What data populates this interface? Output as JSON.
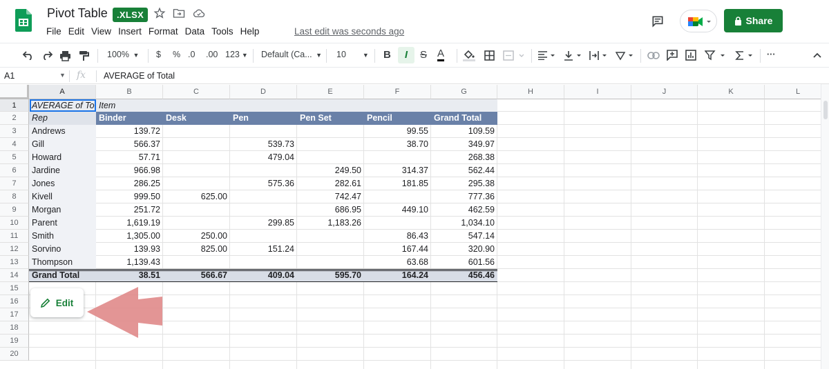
{
  "app": {
    "doc_title": "Pivot Table",
    "file_badge": ".XLSX",
    "menu": [
      "File",
      "Edit",
      "View",
      "Insert",
      "Format",
      "Data",
      "Tools",
      "Help"
    ],
    "last_edit": "Last edit was seconds ago",
    "share_label": "Share"
  },
  "toolbar": {
    "zoom": "100%",
    "currency": "$",
    "percent": "%",
    "dec_decrease": ".0",
    "dec_increase": ".00",
    "more_formats": "123",
    "font": "Default (Ca...",
    "font_size": "10",
    "bold": "B",
    "italic": "I",
    "strike": "S",
    "text_color": "A",
    "more": "···"
  },
  "formula_bar": {
    "cell_ref": "A1",
    "fx": "fx",
    "value": "AVERAGE of Total"
  },
  "columns": [
    "A",
    "B",
    "C",
    "D",
    "E",
    "F",
    "G",
    "H",
    "I",
    "J",
    "K",
    "L"
  ],
  "rows": [
    "1",
    "2",
    "3",
    "4",
    "5",
    "6",
    "7",
    "8",
    "9",
    "10",
    "11",
    "12",
    "13",
    "14",
    "15",
    "16",
    "17",
    "18",
    "19",
    "20"
  ],
  "pivot": {
    "corner_label": "AVERAGE of Tota",
    "col_field": "Item",
    "row_field": "Rep",
    "headers": [
      "Binder",
      "Desk",
      "Pen",
      "Pen Set",
      "Pencil",
      "Grand Total"
    ],
    "data": [
      {
        "rep": "Andrews",
        "vals": [
          "139.72",
          "",
          "",
          "",
          "99.55",
          "109.59"
        ]
      },
      {
        "rep": "Gill",
        "vals": [
          "566.37",
          "",
          "539.73",
          "",
          "38.70",
          "349.97"
        ]
      },
      {
        "rep": "Howard",
        "vals": [
          "57.71",
          "",
          "479.04",
          "",
          "",
          "268.38"
        ]
      },
      {
        "rep": "Jardine",
        "vals": [
          "966.98",
          "",
          "",
          "249.50",
          "314.37",
          "562.44"
        ]
      },
      {
        "rep": "Jones",
        "vals": [
          "286.25",
          "",
          "575.36",
          "282.61",
          "181.85",
          "295.38"
        ]
      },
      {
        "rep": "Kivell",
        "vals": [
          "999.50",
          "625.00",
          "",
          "742.47",
          "",
          "777.36"
        ]
      },
      {
        "rep": "Morgan",
        "vals": [
          "251.72",
          "",
          "",
          "686.95",
          "449.10",
          "462.59"
        ]
      },
      {
        "rep": "Parent",
        "vals": [
          "1,619.19",
          "",
          "299.85",
          "1,183.26",
          "",
          "1,034.10"
        ]
      },
      {
        "rep": "Smith",
        "vals": [
          "1,305.00",
          "250.00",
          "",
          "",
          "86.43",
          "547.14"
        ]
      },
      {
        "rep": "Sorvino",
        "vals": [
          "139.93",
          "825.00",
          "151.24",
          "",
          "167.44",
          "320.90"
        ]
      },
      {
        "rep": "Thompson",
        "vals": [
          "1,139.43",
          "",
          "",
          "",
          "63.68",
          "601.56"
        ]
      }
    ],
    "total_label": "Grand Total",
    "totals": [
      "38.51",
      "566.67",
      "409.04",
      "595.70",
      "164.24",
      "456.46"
    ]
  },
  "edit_label": "Edit",
  "colors": {
    "brand_green": "#188038",
    "pivot_header": "#6a81a8",
    "pivot_total": "#d8dde6",
    "arrow": "#e08a8a"
  }
}
